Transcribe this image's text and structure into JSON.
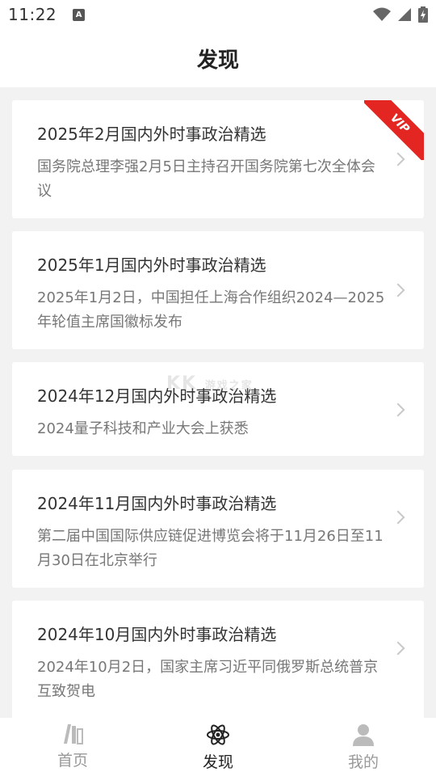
{
  "status_bar": {
    "time": "11:22",
    "notification_glyph": "A"
  },
  "header": {
    "title": "发现"
  },
  "items": [
    {
      "title": "2025年2月国内外时事政治精选",
      "desc": "国务院总理李强2月5日主持召开国务院第七次全体会议",
      "badge": "VIP"
    },
    {
      "title": "2025年1月国内外时事政治精选",
      "desc": "2025年1月2日，中国担任上海合作组织2024—2025年轮值主席国徽标发布"
    },
    {
      "title": "2024年12月国内外时事政治精选",
      "desc": "2024量子科技和产业大会上获悉"
    },
    {
      "title": "2024年11月国内外时事政治精选",
      "desc": "第二届中国国际供应链促进博览会将于11月26日至11月30日在北京举行"
    },
    {
      "title": "2024年10月国内外时事政治精选",
      "desc": "2024年10月2日，国家主席习近平同俄罗斯总统普京互致贺电"
    }
  ],
  "watermark": {
    "text": "KK",
    "small": "游戏之家"
  },
  "tabs": [
    {
      "label": "首页",
      "icon": "books-icon"
    },
    {
      "label": "发现",
      "icon": "atom-icon",
      "active": true
    },
    {
      "label": "我的",
      "icon": "person-icon"
    }
  ],
  "colors": {
    "accent": "#e32621",
    "background": "#f2f2f2",
    "card": "#ffffff"
  }
}
